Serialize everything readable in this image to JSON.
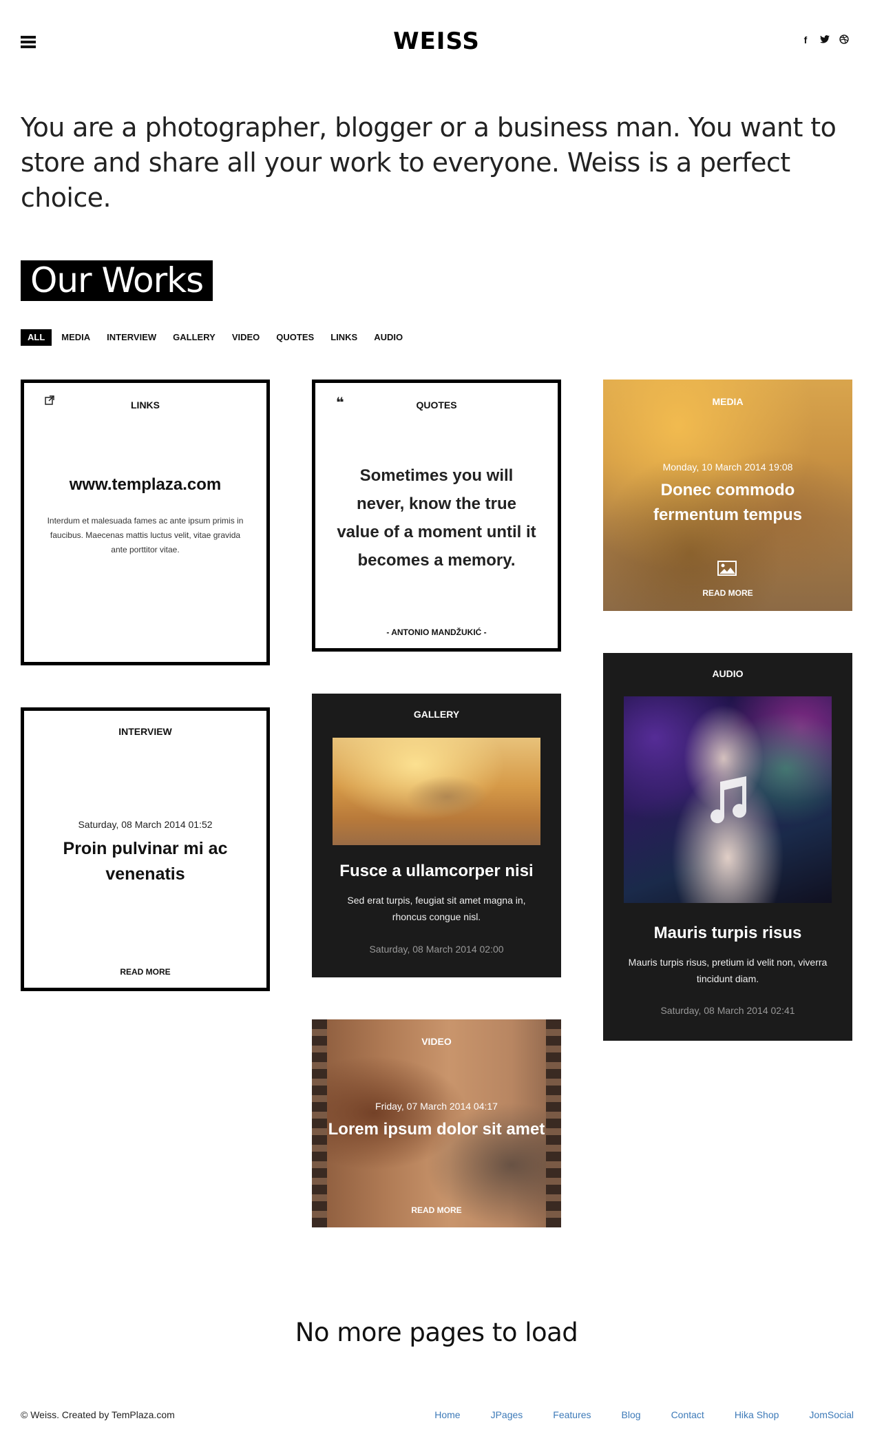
{
  "header": {
    "logo": "WEISS",
    "menu_icon": "hamburger-menu-icon",
    "social": [
      {
        "name": "facebook-icon",
        "glyph": "f"
      },
      {
        "name": "twitter-icon",
        "glyph": "🐦"
      },
      {
        "name": "dribbble-icon",
        "glyph": "⊛"
      }
    ]
  },
  "intro": "You are a photographer, blogger or a business man. You want to store and share all your work to everyone. Weiss is a perfect choice.",
  "section_title": "Our Works",
  "filters": [
    "ALL",
    "MEDIA",
    "INTERVIEW",
    "GALLERY",
    "VIDEO",
    "QUOTES",
    "LINKS",
    "AUDIO"
  ],
  "active_filter": "ALL",
  "cards": {
    "links": {
      "category": "LINKS",
      "icon": "external-link-icon",
      "url": "www.templaza.com",
      "text": "Interdum et malesuada fames ac ante ipsum primis in faucibus. Maecenas mattis luctus velit, vitae gravida ante porttitor vitae."
    },
    "quotes": {
      "category": "QUOTES",
      "icon": "quote-icon",
      "quote": "Sometimes you will never, know the true value of a moment until it becomes a memory.",
      "author": "- ANTONIO MANDŽUKIĆ -"
    },
    "media": {
      "category": "MEDIA",
      "date": "Monday, 10 March 2014 19:08",
      "title": "Donec commodo fermentum tempus",
      "icon": "image-icon",
      "read_more": "READ MORE"
    },
    "interview": {
      "category": "INTERVIEW",
      "date": "Saturday, 08 March 2014 01:52",
      "title": "Proin pulvinar mi ac venenatis",
      "read_more": "READ MORE"
    },
    "gallery": {
      "category": "GALLERY",
      "title": "Fusce a ullamcorper nisi",
      "text": "Sed erat turpis, feugiat sit amet magna in, rhoncus congue nisl.",
      "date": "Saturday, 08 March 2014 02:00"
    },
    "audio": {
      "category": "AUDIO",
      "title": "Mauris turpis risus",
      "text": "Mauris turpis risus, pretium id velit non, viverra tincidunt diam.",
      "date": "Saturday, 08 March 2014 02:41",
      "icon": "music-note-icon"
    },
    "video": {
      "category": "VIDEO",
      "date": "Friday, 07 March 2014 04:17",
      "title": "Lorem ipsum dolor sit amet",
      "read_more": "READ MORE"
    }
  },
  "no_more": "No more pages to load",
  "footer": {
    "copyright": "© Weiss. Created by TemPlaza.com",
    "nav": [
      "Home",
      "JPages",
      "Features",
      "Blog",
      "Contact",
      "Hika Shop",
      "JomSocial"
    ]
  },
  "colors": {
    "accent_link": "#3d7ab8",
    "dark_card": "#1b1b1b",
    "black": "#000000"
  }
}
